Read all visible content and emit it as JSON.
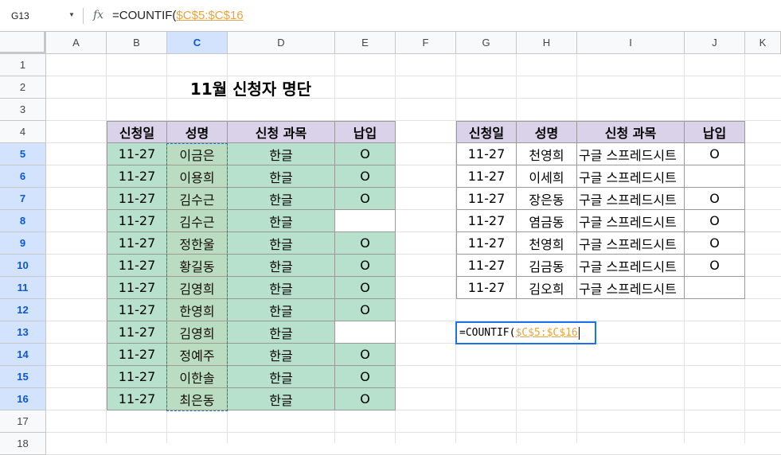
{
  "formula_bar": {
    "cell_ref": "G13",
    "fx_label": "fx",
    "formula_prefix": "=COUNTIF(",
    "formula_range": "$C$5:$C$16"
  },
  "columns": [
    "A",
    "B",
    "C",
    "D",
    "E",
    "F",
    "G",
    "H",
    "I",
    "J",
    "K"
  ],
  "selected_column": "C",
  "rows": [
    "1",
    "2",
    "3",
    "4",
    "5",
    "6",
    "7",
    "8",
    "9",
    "10",
    "11",
    "12",
    "13",
    "14",
    "15",
    "16",
    "17",
    "18"
  ],
  "selected_rows": [
    "5",
    "6",
    "7",
    "8",
    "9",
    "10",
    "11",
    "12",
    "13",
    "14",
    "15",
    "16"
  ],
  "title": "11월 신청자 명단",
  "table1": {
    "headers": [
      "신청일",
      "성명",
      "신청 과목",
      "납입"
    ],
    "rows": [
      [
        "11-27",
        "이금은",
        "한글",
        "O"
      ],
      [
        "11-27",
        "이용희",
        "한글",
        "O"
      ],
      [
        "11-27",
        "김수근",
        "한글",
        "O"
      ],
      [
        "11-27",
        "김수근",
        "한글",
        ""
      ],
      [
        "11-27",
        "정한울",
        "한글",
        "O"
      ],
      [
        "11-27",
        "황길동",
        "한글",
        "O"
      ],
      [
        "11-27",
        "김영희",
        "한글",
        "O"
      ],
      [
        "11-27",
        "한영희",
        "한글",
        "O"
      ],
      [
        "11-27",
        "김영희",
        "한글",
        ""
      ],
      [
        "11-27",
        "정예주",
        "한글",
        "O"
      ],
      [
        "11-27",
        "이한솔",
        "한글",
        "O"
      ],
      [
        "11-27",
        "최은동",
        "한글",
        "O"
      ]
    ]
  },
  "table2": {
    "headers": [
      "신청일",
      "성명",
      "신청 과목",
      "납입"
    ],
    "rows": [
      [
        "11-27",
        "천영희",
        "구글 스프레드시트",
        "O"
      ],
      [
        "11-27",
        "이세희",
        "구글 스프레드시트",
        ""
      ],
      [
        "11-27",
        "장은동",
        "구글 스프레드시트",
        "O"
      ],
      [
        "11-27",
        "염금동",
        "구글 스프레드시트",
        "O"
      ],
      [
        "11-27",
        "천영희",
        "구글 스프레드시트",
        "O"
      ],
      [
        "11-27",
        "김금동",
        "구글 스프레드시트",
        "O"
      ],
      [
        "11-27",
        "김오희",
        "구글 스프레드시트",
        ""
      ]
    ]
  },
  "editor": {
    "prefix": "=COUNTIF(",
    "range": "$C$5:$C$16"
  },
  "colors": {
    "green_fill": "#b7e1cd",
    "purple_header": "#d9d2e9",
    "selection_blue": "#1a73e8",
    "range_orange": "#e8a33d"
  }
}
